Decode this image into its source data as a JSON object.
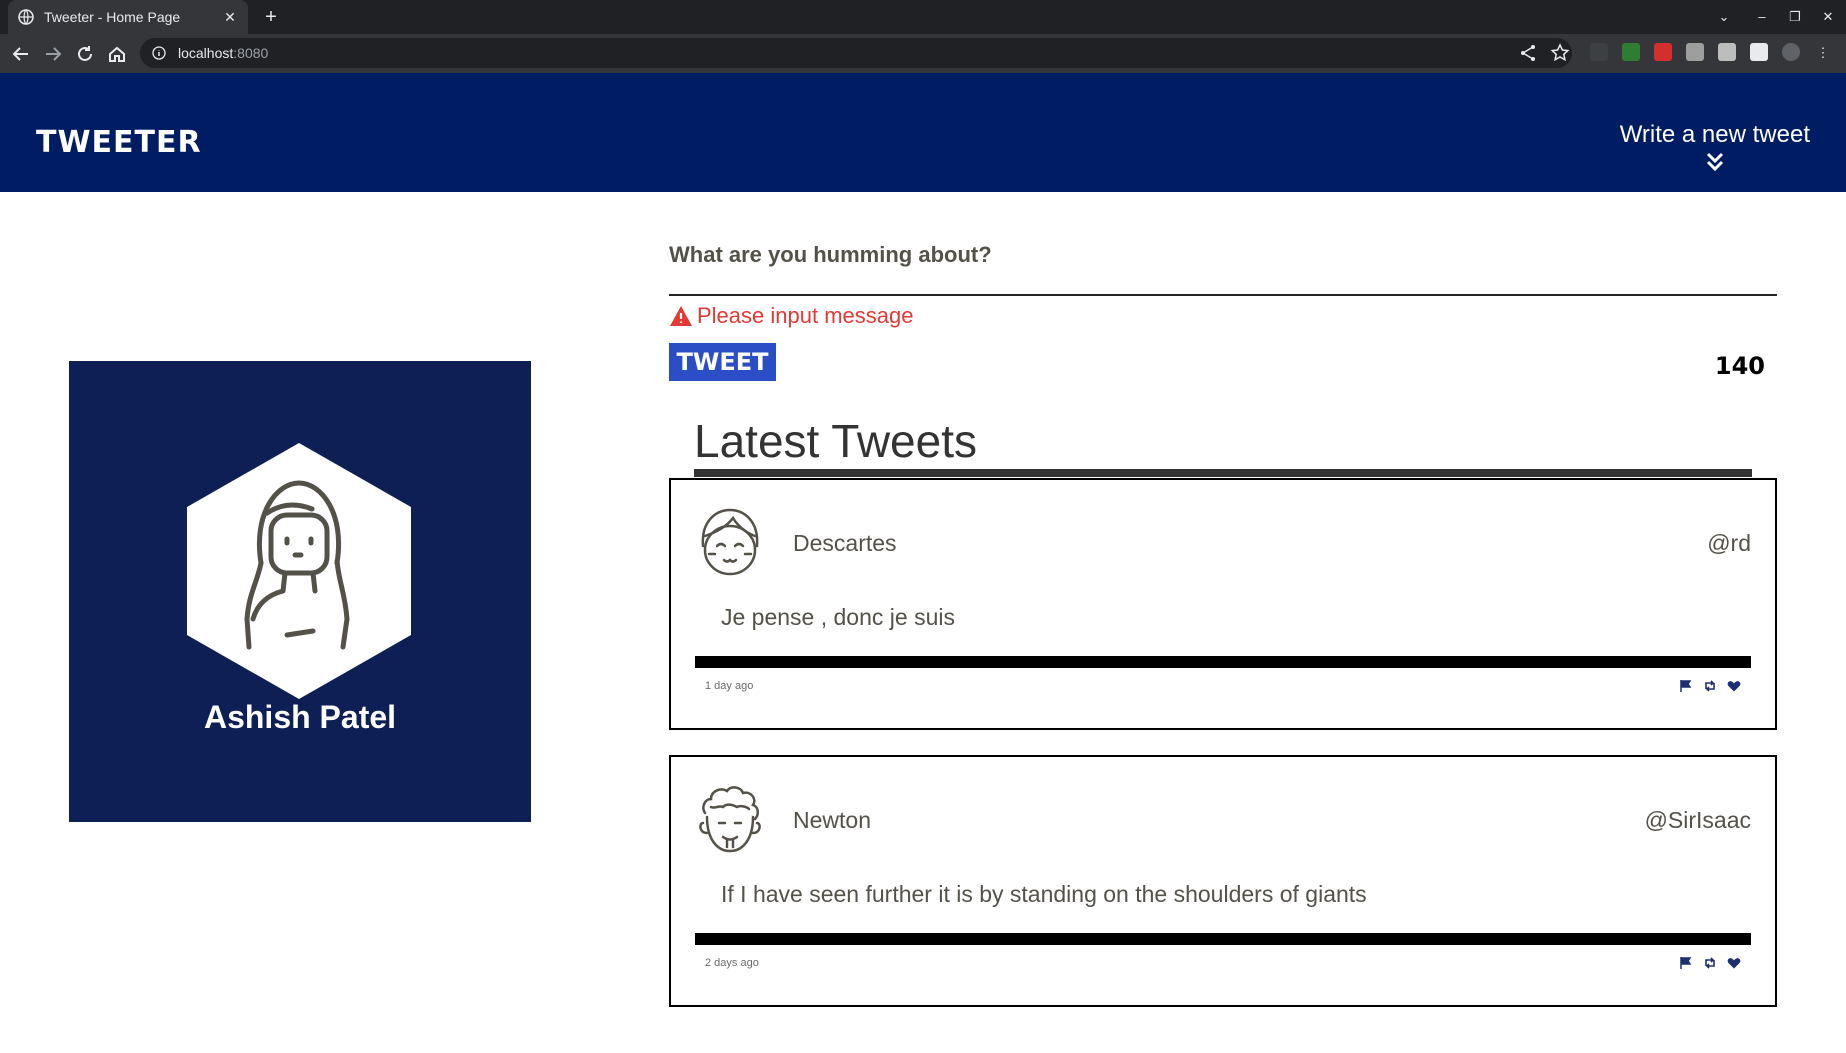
{
  "browser": {
    "tab_title": "Tweeter - Home Page",
    "url_host": "localhost",
    "url_port": ":8080",
    "close_glyph": "✕",
    "new_tab_glyph": "+"
  },
  "header": {
    "brand": "TWEETER",
    "compose_label": "Write a new tweet"
  },
  "profile": {
    "name": "Ashish Patel"
  },
  "composer": {
    "prompt": "What are you humming about?",
    "error": "Please input message",
    "submit_label": "TWEET",
    "counter": "140"
  },
  "feed": {
    "title": "Latest Tweets",
    "tweets": [
      {
        "author": "Descartes",
        "handle": "@rd",
        "content": "Je pense , donc je suis",
        "time": "1 day ago"
      },
      {
        "author": "Newton",
        "handle": "@SirIsaac",
        "content": "If I have seen further it is by standing on the shoulders of giants",
        "time": "2 days ago"
      }
    ]
  },
  "colors": {
    "header_bg": "#001d63",
    "profile_bg": "#0e1f56",
    "button_bg": "#2b4ec6",
    "error": "#e53935",
    "action_icons": "#1d2f6e"
  },
  "icons": [
    "globe-icon",
    "info-icon",
    "share-icon",
    "star-icon",
    "double-chevron-down-icon",
    "warning-icon",
    "flag-icon",
    "retweet-icon",
    "heart-icon"
  ]
}
